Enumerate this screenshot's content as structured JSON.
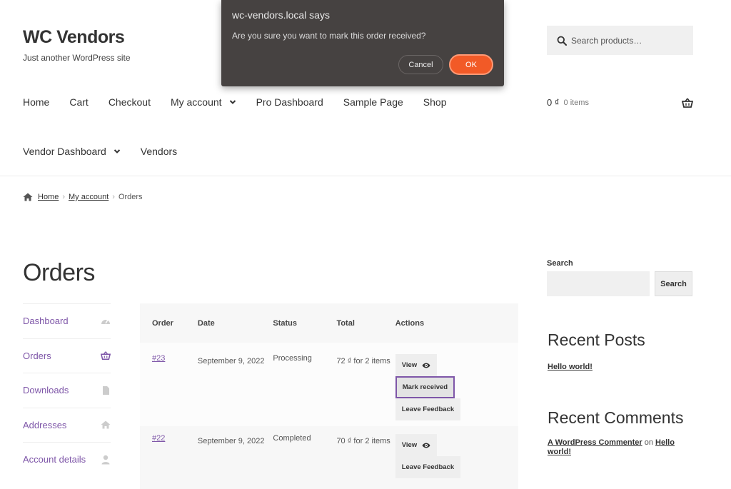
{
  "site": {
    "title": "WC Vendors",
    "tagline": "Just another WordPress site"
  },
  "header_search": {
    "placeholder": "Search products…",
    "icon": "search-icon"
  },
  "nav": {
    "row1": [
      "Home",
      "Cart",
      "Checkout",
      "My account",
      "Pro Dashboard",
      "Sample Page",
      "Shop"
    ],
    "row2": [
      "Vendor Dashboard",
      "Vendors"
    ]
  },
  "cart": {
    "amount": "0 ₫",
    "items": "0 items",
    "icon": "basket-icon"
  },
  "breadcrumb": {
    "home": "Home",
    "my_account": "My account",
    "current": "Orders",
    "sep": "›"
  },
  "page": {
    "title": "Orders"
  },
  "account_nav": [
    {
      "label": "Dashboard",
      "icon": "gauge-icon"
    },
    {
      "label": "Orders",
      "icon": "basket-icon"
    },
    {
      "label": "Downloads",
      "icon": "file-icon"
    },
    {
      "label": "Addresses",
      "icon": "home-icon"
    },
    {
      "label": "Account details",
      "icon": "user-icon"
    }
  ],
  "orders_table": {
    "headers": {
      "order": "Order",
      "date": "Date",
      "status": "Status",
      "total": "Total",
      "actions": "Actions"
    },
    "rows": [
      {
        "order": "#23",
        "date": "September 9, 2022",
        "status": "Processing",
        "total": "72 ₫ for 2 items",
        "actions": [
          "View",
          "Mark received",
          "Leave Feedback"
        ]
      },
      {
        "order": "#22",
        "date": "September 9, 2022",
        "status": "Completed",
        "total": "70 ₫ for 2 items",
        "actions": [
          "View",
          "Leave Feedback"
        ]
      }
    ]
  },
  "sidebar": {
    "search_label": "Search",
    "search_button": "Search",
    "recent_posts_title": "Recent Posts",
    "post": "Hello world!",
    "recent_comments_title": "Recent Comments",
    "comment_author": "A WordPress Commenter",
    "comment_on": "on",
    "comment_post": "Hello world!"
  },
  "dialog": {
    "origin": "wc-vendors.local says",
    "message": "Are you sure you want to mark this order received?",
    "cancel": "Cancel",
    "ok": "OK"
  },
  "colors": {
    "accent": "#7e56a8",
    "ok_button": "#f25a27",
    "dialog_bg": "#464241"
  }
}
